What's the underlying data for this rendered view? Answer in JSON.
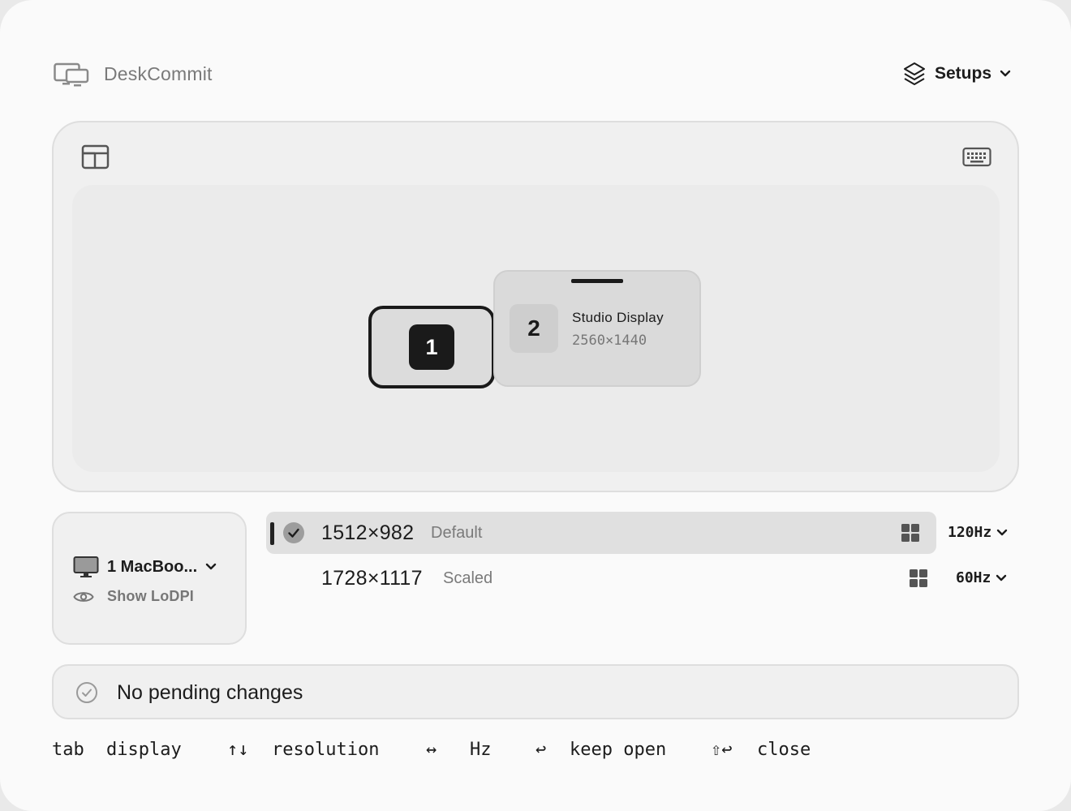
{
  "header": {
    "app_title": "DeskCommit",
    "app_icon": "displays-icon",
    "setups_label": "Setups",
    "setups_icon": "layers-icon"
  },
  "arrangement": {
    "layout_icon": "layout-icon",
    "keyboard_icon": "keyboard-icon",
    "displays": [
      {
        "number": "1",
        "selected": true
      },
      {
        "number": "2",
        "name": "Studio Display",
        "resolution": "2560×1440",
        "has_menu_bar": true
      }
    ]
  },
  "display_panel": {
    "selected_display": "1 MacBoo...",
    "display_icon": "monitor-icon",
    "lodpi_label": "Show LoDPI",
    "lodpi_icon": "eye-icon"
  },
  "resolutions": [
    {
      "value": "1512×982",
      "tag": "Default",
      "selected": true,
      "refresh": "120Hz"
    },
    {
      "value": "1728×1117",
      "tag": "Scaled",
      "selected": false,
      "refresh": "60Hz"
    }
  ],
  "status": {
    "text": "No pending changes",
    "icon": "check-circle-icon"
  },
  "hints": [
    {
      "key": "tab",
      "action": "display"
    },
    {
      "key": "↑↓",
      "action": "resolution"
    },
    {
      "key": "↔",
      "action": "Hz"
    },
    {
      "key": "↩",
      "action": "keep open"
    },
    {
      "key": "⇧↩",
      "action": "close"
    }
  ],
  "colors": {
    "background": "#fafafa",
    "panel": "#f0f0f0",
    "selected_row": "#e0e0e0",
    "accent_dark": "#1a1a1a",
    "muted_text": "#7a7a7a"
  }
}
